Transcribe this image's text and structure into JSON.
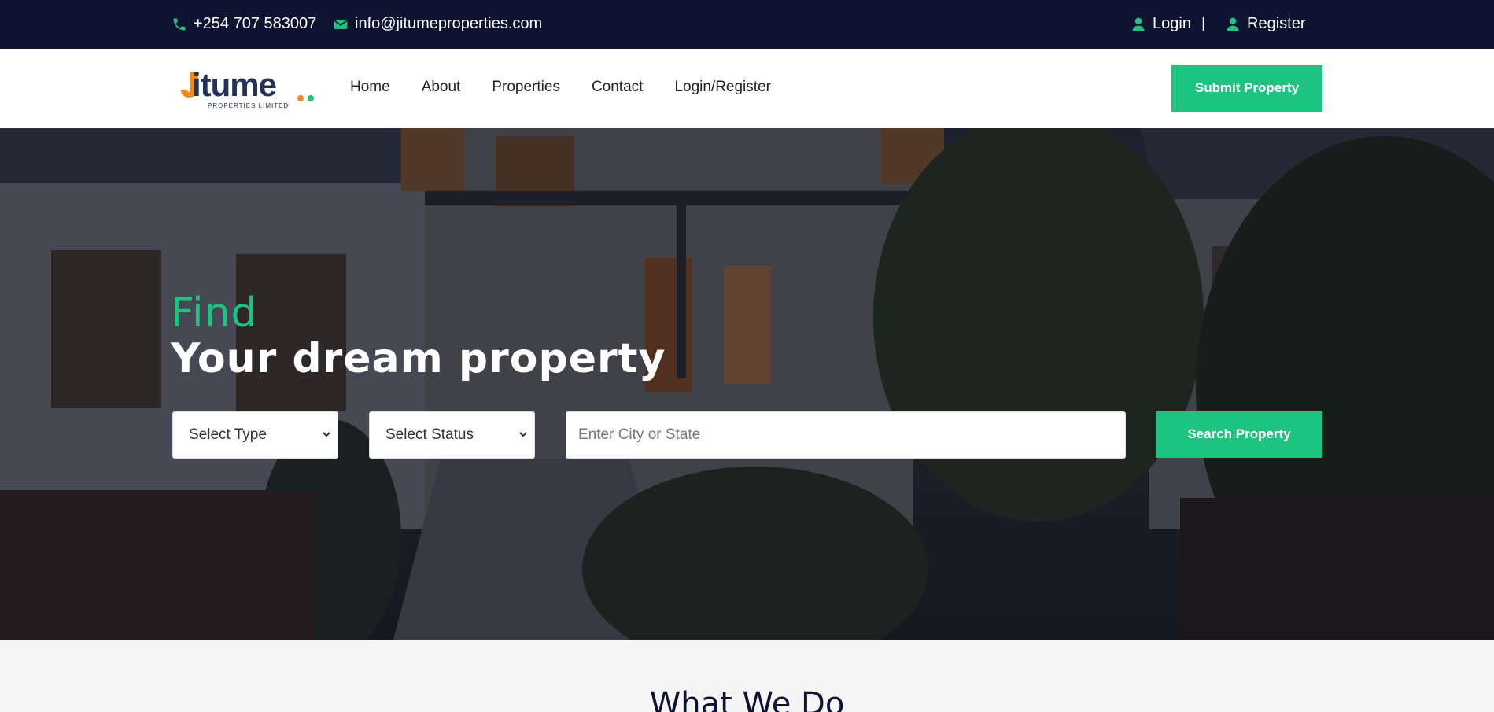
{
  "topbar": {
    "phone": "+254 707 583007",
    "email": "info@jitumeproperties.com",
    "login": "Login",
    "separator": "|",
    "register": "Register",
    "icons": {
      "phone": "phone-icon",
      "email": "envelope-icon",
      "user": "user-icon"
    }
  },
  "nav": {
    "logo_text": "itume",
    "logo_sub": "PROPERTIES LIMITED",
    "links": [
      "Home",
      "About",
      "Properties",
      "Contact",
      "Login/Register"
    ],
    "submit_label": "Submit Property"
  },
  "hero": {
    "find": "Find",
    "headline": "Your dream property",
    "select_type": "Select Type",
    "select_status": "Select Status",
    "city_placeholder": "Enter City or State",
    "search_label": "Search Property"
  },
  "section": {
    "title": "What We Do"
  },
  "colors": {
    "accent": "#1cc47f",
    "topbar": "#0d1331"
  }
}
